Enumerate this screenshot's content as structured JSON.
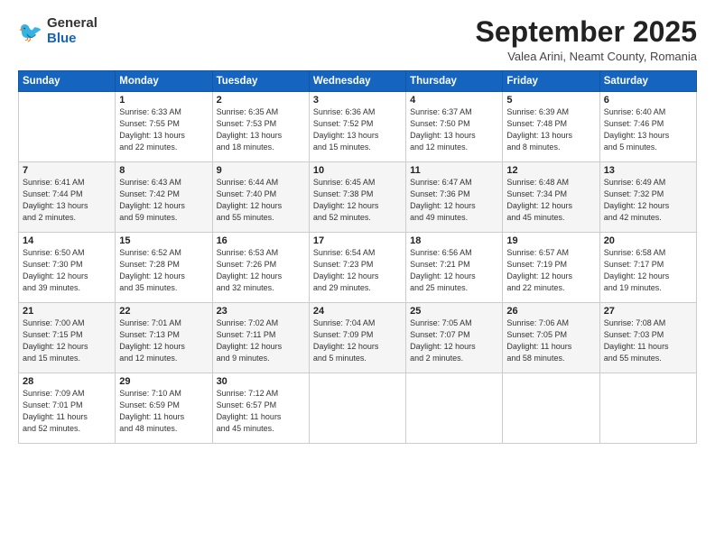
{
  "logo": {
    "general": "General",
    "blue": "Blue"
  },
  "header": {
    "month_title": "September 2025",
    "subtitle": "Valea Arini, Neamt County, Romania"
  },
  "weekdays": [
    "Sunday",
    "Monday",
    "Tuesday",
    "Wednesday",
    "Thursday",
    "Friday",
    "Saturday"
  ],
  "weeks": [
    [
      {
        "day": "",
        "info": ""
      },
      {
        "day": "1",
        "info": "Sunrise: 6:33 AM\nSunset: 7:55 PM\nDaylight: 13 hours\nand 22 minutes."
      },
      {
        "day": "2",
        "info": "Sunrise: 6:35 AM\nSunset: 7:53 PM\nDaylight: 13 hours\nand 18 minutes."
      },
      {
        "day": "3",
        "info": "Sunrise: 6:36 AM\nSunset: 7:52 PM\nDaylight: 13 hours\nand 15 minutes."
      },
      {
        "day": "4",
        "info": "Sunrise: 6:37 AM\nSunset: 7:50 PM\nDaylight: 13 hours\nand 12 minutes."
      },
      {
        "day": "5",
        "info": "Sunrise: 6:39 AM\nSunset: 7:48 PM\nDaylight: 13 hours\nand 8 minutes."
      },
      {
        "day": "6",
        "info": "Sunrise: 6:40 AM\nSunset: 7:46 PM\nDaylight: 13 hours\nand 5 minutes."
      }
    ],
    [
      {
        "day": "7",
        "info": "Sunrise: 6:41 AM\nSunset: 7:44 PM\nDaylight: 13 hours\nand 2 minutes."
      },
      {
        "day": "8",
        "info": "Sunrise: 6:43 AM\nSunset: 7:42 PM\nDaylight: 12 hours\nand 59 minutes."
      },
      {
        "day": "9",
        "info": "Sunrise: 6:44 AM\nSunset: 7:40 PM\nDaylight: 12 hours\nand 55 minutes."
      },
      {
        "day": "10",
        "info": "Sunrise: 6:45 AM\nSunset: 7:38 PM\nDaylight: 12 hours\nand 52 minutes."
      },
      {
        "day": "11",
        "info": "Sunrise: 6:47 AM\nSunset: 7:36 PM\nDaylight: 12 hours\nand 49 minutes."
      },
      {
        "day": "12",
        "info": "Sunrise: 6:48 AM\nSunset: 7:34 PM\nDaylight: 12 hours\nand 45 minutes."
      },
      {
        "day": "13",
        "info": "Sunrise: 6:49 AM\nSunset: 7:32 PM\nDaylight: 12 hours\nand 42 minutes."
      }
    ],
    [
      {
        "day": "14",
        "info": "Sunrise: 6:50 AM\nSunset: 7:30 PM\nDaylight: 12 hours\nand 39 minutes."
      },
      {
        "day": "15",
        "info": "Sunrise: 6:52 AM\nSunset: 7:28 PM\nDaylight: 12 hours\nand 35 minutes."
      },
      {
        "day": "16",
        "info": "Sunrise: 6:53 AM\nSunset: 7:26 PM\nDaylight: 12 hours\nand 32 minutes."
      },
      {
        "day": "17",
        "info": "Sunrise: 6:54 AM\nSunset: 7:23 PM\nDaylight: 12 hours\nand 29 minutes."
      },
      {
        "day": "18",
        "info": "Sunrise: 6:56 AM\nSunset: 7:21 PM\nDaylight: 12 hours\nand 25 minutes."
      },
      {
        "day": "19",
        "info": "Sunrise: 6:57 AM\nSunset: 7:19 PM\nDaylight: 12 hours\nand 22 minutes."
      },
      {
        "day": "20",
        "info": "Sunrise: 6:58 AM\nSunset: 7:17 PM\nDaylight: 12 hours\nand 19 minutes."
      }
    ],
    [
      {
        "day": "21",
        "info": "Sunrise: 7:00 AM\nSunset: 7:15 PM\nDaylight: 12 hours\nand 15 minutes."
      },
      {
        "day": "22",
        "info": "Sunrise: 7:01 AM\nSunset: 7:13 PM\nDaylight: 12 hours\nand 12 minutes."
      },
      {
        "day": "23",
        "info": "Sunrise: 7:02 AM\nSunset: 7:11 PM\nDaylight: 12 hours\nand 9 minutes."
      },
      {
        "day": "24",
        "info": "Sunrise: 7:04 AM\nSunset: 7:09 PM\nDaylight: 12 hours\nand 5 minutes."
      },
      {
        "day": "25",
        "info": "Sunrise: 7:05 AM\nSunset: 7:07 PM\nDaylight: 12 hours\nand 2 minutes."
      },
      {
        "day": "26",
        "info": "Sunrise: 7:06 AM\nSunset: 7:05 PM\nDaylight: 11 hours\nand 58 minutes."
      },
      {
        "day": "27",
        "info": "Sunrise: 7:08 AM\nSunset: 7:03 PM\nDaylight: 11 hours\nand 55 minutes."
      }
    ],
    [
      {
        "day": "28",
        "info": "Sunrise: 7:09 AM\nSunset: 7:01 PM\nDaylight: 11 hours\nand 52 minutes."
      },
      {
        "day": "29",
        "info": "Sunrise: 7:10 AM\nSunset: 6:59 PM\nDaylight: 11 hours\nand 48 minutes."
      },
      {
        "day": "30",
        "info": "Sunrise: 7:12 AM\nSunset: 6:57 PM\nDaylight: 11 hours\nand 45 minutes."
      },
      {
        "day": "",
        "info": ""
      },
      {
        "day": "",
        "info": ""
      },
      {
        "day": "",
        "info": ""
      },
      {
        "day": "",
        "info": ""
      }
    ]
  ]
}
